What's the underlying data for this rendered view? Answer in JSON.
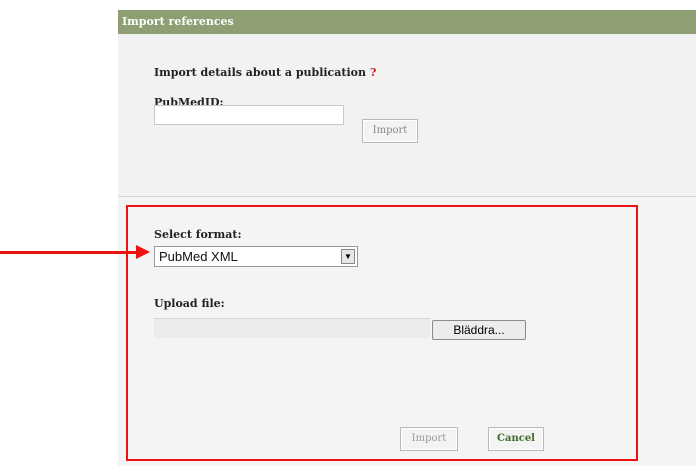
{
  "dialog": {
    "title": "Import references"
  },
  "pubmed_section": {
    "heading": "Import details about a publication",
    "help_mark": "?",
    "pubmed_label": "PubMedID:",
    "pubmed_value": "",
    "import_button": "Import"
  },
  "file_section": {
    "format_label": "Select format:",
    "format_selected": "PubMed XML",
    "select_arrow_glyph": "▼",
    "upload_label": "Upload file:",
    "browse_button": "Bläddra...",
    "import_button": "Import",
    "cancel_button": "Cancel"
  },
  "annotation": {
    "color": "#ee1111"
  }
}
